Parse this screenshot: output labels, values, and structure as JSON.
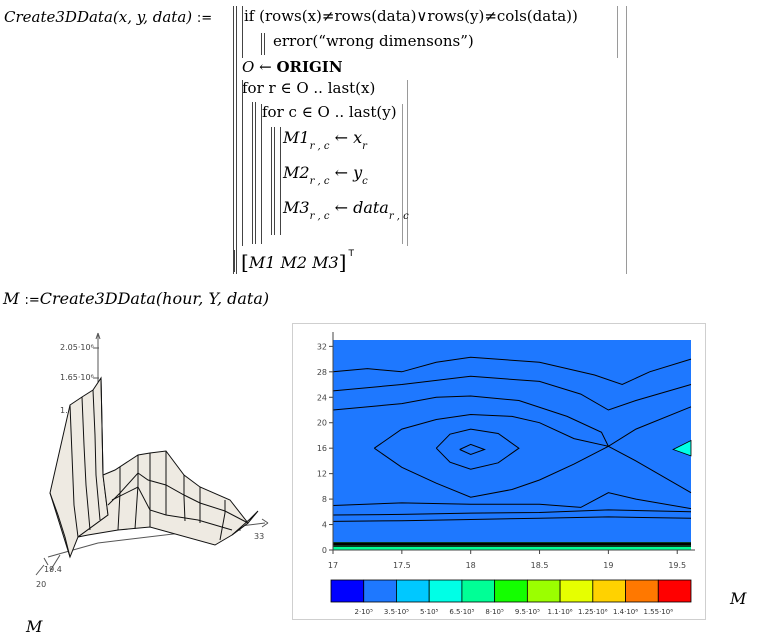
{
  "program": {
    "func_name": "Create3DData",
    "func_params": "(x, y, data)",
    "define_op": ":=",
    "if_kw": "if",
    "condition": "(rows(x)≠rows(data)∨rows(y)≠cols(data))",
    "error_call": "error(“wrong dimensons”)",
    "origin_lhs": "O",
    "arrow": "←",
    "origin_rhs": "ORIGIN",
    "for_r": "for r ∈ O .. last(x)",
    "for_c": "for c ∈ O .. last(y)",
    "assign1_lhs": "M1",
    "assign1_sub": "r , c",
    "assign1_rhs": "x",
    "assign1_rsub": "r",
    "assign2_lhs": "M2",
    "assign2_sub": "r , c",
    "assign2_rhs": "y",
    "assign2_rsub": "c",
    "assign3_lhs": "M3",
    "assign3_sub": "r , c",
    "assign3_rhs": "data",
    "assign3_rsub": "r , c",
    "return_expr": "M1  M2  M3",
    "transpose": "T"
  },
  "call": {
    "lhs": "M",
    "define_op": ":=",
    "func": "Create3DData",
    "args": "(hour, Y, data)"
  },
  "surface_plot": {
    "z_tick_top": "2.05·10⁶",
    "z_tick_mid": "1.65·10⁶",
    "z_tick_low": "1.",
    "x_tick_near": "19.4",
    "x_tick_far": "20",
    "y_tick_end": "33",
    "caption": "M"
  },
  "contour_plot": {
    "caption": "M",
    "chart_data": {
      "type": "heatmap",
      "x": [
        17,
        17.5,
        18,
        18.5,
        19,
        19.5
      ],
      "y_ticks": [
        0,
        4,
        8,
        12,
        16,
        20,
        24,
        28,
        32
      ],
      "xlim": [
        17,
        19.6
      ],
      "ylim": [
        0,
        33
      ],
      "grid": false,
      "colorbar_labels": [
        "2·10⁵",
        "3.5·10⁵",
        "5·10⁵",
        "6.5·10⁵",
        "8·10⁵",
        "9.5·10⁵",
        "1.1·10⁶",
        "1.25·10⁶",
        "1.4·10⁶",
        "1.55·10⁶"
      ],
      "colorbar_colors": [
        "#0000ff",
        "#1e78ff",
        "#00c8ff",
        "#00ffe6",
        "#00ff96",
        "#14ff00",
        "#9bff00",
        "#e6ff00",
        "#ffd200",
        "#ff7800",
        "#ff0000"
      ],
      "legend_position": "bottom"
    }
  }
}
